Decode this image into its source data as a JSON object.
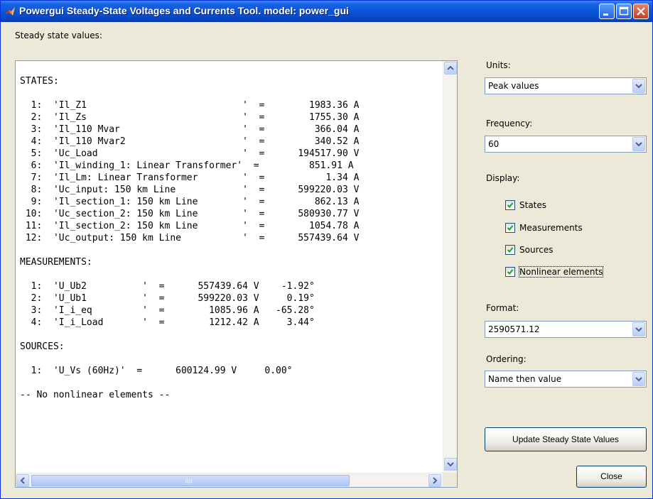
{
  "window": {
    "title": "Powergui Steady-State Voltages and Currents Tool.  model: power_gui"
  },
  "steady_label": "Steady state values:",
  "report_lines": [
    "STATES:",
    "",
    "  1:  'Il_Z1                            '  =        1983.36 A",
    "  2:  'Il_Zs                            '  =        1755.30 A",
    "  3:  'Il_110 Mvar                      '  =         366.04 A",
    "  4:  'Il_110 Mvar2                     '  =         340.52 A",
    "  5:  'Uc_Load                          '  =      194517.90 V",
    "  6:  'Il_winding_1: Linear Transformer'  =         851.91 A",
    "  7:  'Il_Lm: Linear Transformer        '  =           1.34 A",
    "  8:  'Uc_input: 150 km Line            '  =      599220.03 V",
    "  9:  'Il_section_1: 150 km Line        '  =         862.13 A",
    " 10:  'Uc_section_2: 150 km Line        '  =      580930.77 V",
    " 11:  'Il_section_2: 150 km Line        '  =        1054.78 A",
    " 12:  'Uc_output: 150 km Line           '  =      557439.64 V",
    "",
    "MEASUREMENTS:",
    "",
    "  1:  'U_Ub2          '  =      557439.64 V    -1.92°",
    "  2:  'U_Ub1          '  =      599220.03 V     0.19°",
    "  3:  'I_i_eq         '  =        1085.96 A   -65.28°",
    "  4:  'I_i_Load       '  =        1212.42 A     3.44°",
    "",
    "SOURCES:",
    "",
    "  1:  'U_Vs (60Hz)'  =      600124.99 V     0.00°",
    "",
    "-- No nonlinear elements --"
  ],
  "units": {
    "label": "Units:",
    "value": "Peak values"
  },
  "frequency": {
    "label": "Frequency:",
    "value": "60"
  },
  "display": {
    "label": "Display:",
    "items": [
      {
        "label": "States",
        "checked": true
      },
      {
        "label": "Measurements",
        "checked": true
      },
      {
        "label": "Sources",
        "checked": true
      },
      {
        "label": "Nonlinear elements",
        "checked": true
      }
    ]
  },
  "format": {
    "label": "Format:",
    "value": "2590571.12"
  },
  "ordering": {
    "label": "Ordering:",
    "value": "Name then value"
  },
  "update_button": "Update Steady State Values",
  "close_button": "Close"
}
